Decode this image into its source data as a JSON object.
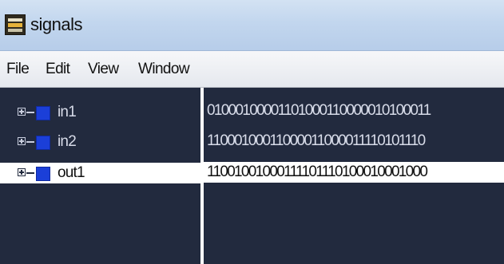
{
  "window": {
    "title": "signals"
  },
  "menu": {
    "items": [
      "File",
      "Edit",
      "View",
      "Window"
    ]
  },
  "signals": [
    {
      "name": "in1",
      "value": "01000100001101000110000010100011",
      "color": "#1b3fd8",
      "selected": false
    },
    {
      "name": "in2",
      "value": "11000100011000011000011110101110",
      "color": "#1b3fd8",
      "selected": false
    },
    {
      "name": "out1",
      "value": "11001001000111101110100010001000",
      "color": "#1b3fd8",
      "selected": true
    }
  ],
  "icons": {
    "app": "signals-app-icon",
    "expand": "expand-plus-icon",
    "swatch": "signal-color-swatch"
  }
}
